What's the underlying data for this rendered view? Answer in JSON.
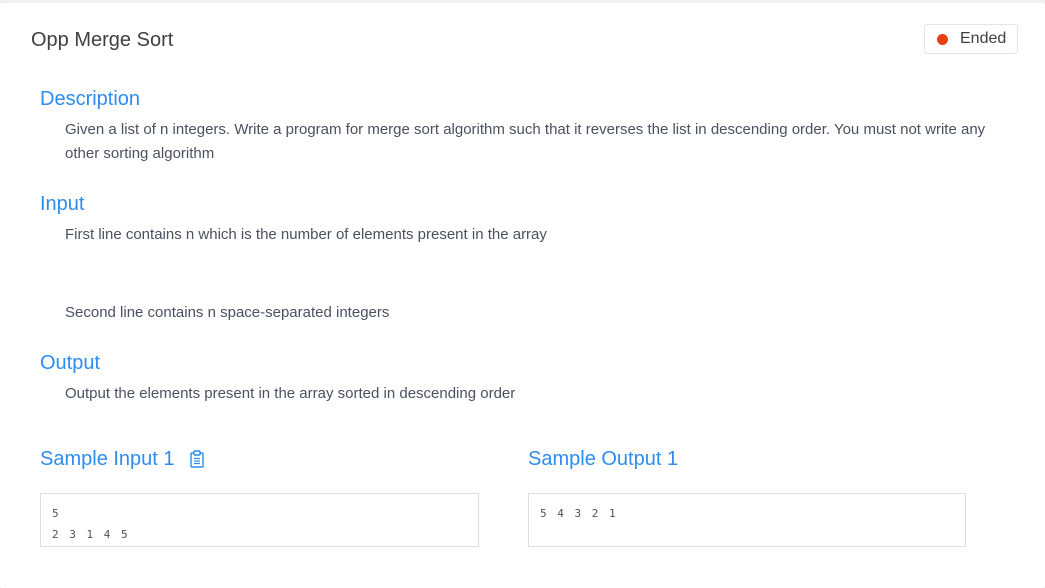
{
  "problem": {
    "title": "Opp Merge Sort",
    "status": "Ended",
    "status_color": "#ea3e13"
  },
  "sections": {
    "description": {
      "title": "Description",
      "body": "Given a list of n integers. Write a program for merge sort algorithm such that it reverses the list in descending order.  You must not write any other sorting algorithm"
    },
    "input": {
      "title": "Input",
      "line1": "First line contains n which is the number of elements present in the array",
      "line2": "Second line contains n space-separated integers"
    },
    "output": {
      "title": "Output",
      "body": "Output the elements present in the array sorted in descending order"
    }
  },
  "samples": {
    "input_title": "Sample Input 1",
    "input_value": "5\n2 3 1 4 5",
    "output_title": "Sample Output 1",
    "output_value": "5 4 3 2 1",
    "copy_icon": "clipboard-icon"
  },
  "colors": {
    "accent": "#2d8cf0",
    "text": "#495060",
    "title_text": "#404040"
  }
}
